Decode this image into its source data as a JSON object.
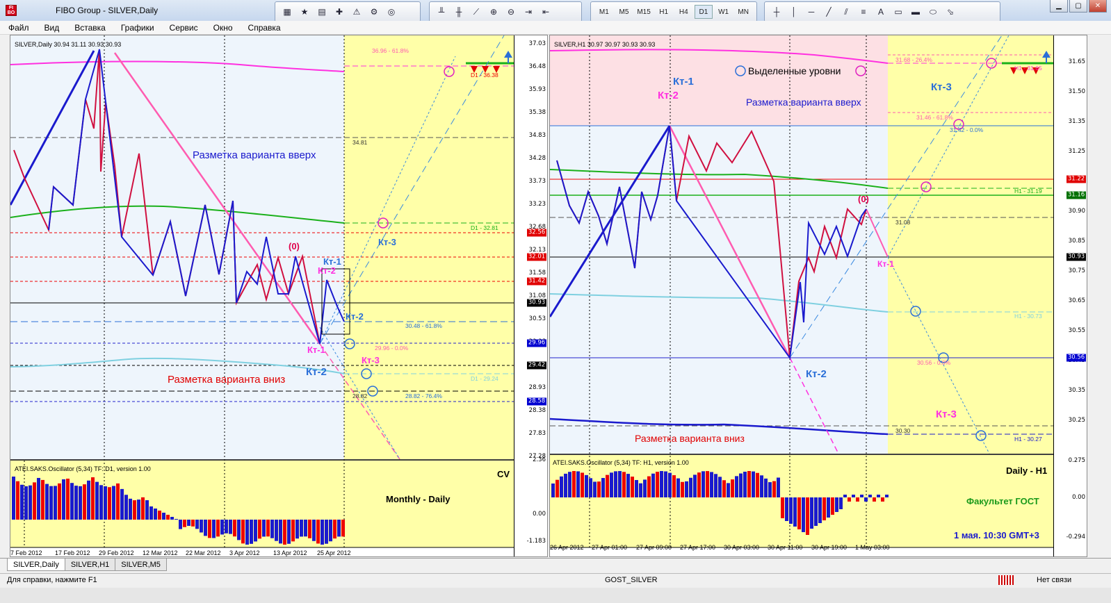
{
  "window": {
    "title": "FIBO Group - SILVER,Daily"
  },
  "menu": [
    "Файл",
    "Вид",
    "Вставка",
    "Графики",
    "Сервис",
    "Окно",
    "Справка"
  ],
  "toolbar": {
    "timeframes": [
      "M1",
      "M5",
      "M15",
      "H1",
      "H4",
      "D1",
      "W1",
      "MN"
    ],
    "selected_tf": "D1"
  },
  "left_chart": {
    "header": "SILVER,Daily  30.94 31.11 30.93 30.93",
    "price_ticks": [
      "37.03",
      "36.48",
      "35.93",
      "35.38",
      "34.83",
      "34.28",
      "33.73",
      "33.23",
      "32.68",
      "32.13",
      "31.58",
      "31.08",
      "30.53",
      "29.98",
      "29.43",
      "28.93",
      "28.38",
      "27.83",
      "27.28"
    ],
    "price_tags": [
      {
        "text": "32.56",
        "color": "red"
      },
      {
        "text": "32.01",
        "color": "red"
      },
      {
        "text": "31.42",
        "color": "red"
      },
      {
        "text": "30.93",
        "color": "black"
      },
      {
        "text": "29.96",
        "color": "blue"
      },
      {
        "text": "29.42",
        "color": "black"
      },
      {
        "text": "28.58",
        "color": "blue"
      }
    ],
    "level_labels": [
      "36.96 - 61.8%",
      "D1 - 36.38",
      "34.81",
      "D1 - 32.81",
      "30.48 - 61.8%",
      "29.96 - 0.0%",
      "D1 - 29.24",
      "28.82",
      "28.82 - 76.4%"
    ],
    "annotations": {
      "up_variant": "Разметка варианта вверх",
      "down_variant": "Разметка варианта вниз",
      "kt1_top": "Кт-1",
      "kt2_top": "Кт-2",
      "kt2_mid": "Кт-2",
      "kt3_top": "Кт-3",
      "kt1_low": "Кт-1",
      "kt3_low": "Кт-3",
      "kt2_low": "Кт-2",
      "zero": "(0)"
    },
    "oscillator": {
      "header": "ATEI.SAKS.Oscillator (5,34)  TF: D1, version 1.00",
      "ticks": [
        "2.36",
        "0.00",
        "-1.183"
      ],
      "label_cv": "CV",
      "label_period": "Monthly - Daily"
    },
    "dates": [
      "7 Feb 2012",
      "17 Feb 2012",
      "29 Feb 2012",
      "12 Mar 2012",
      "22 Mar 2012",
      "3 Apr 2012",
      "13 Apr 2012",
      "25 Apr 2012"
    ]
  },
  "right_chart": {
    "header": "SILVER,H1  30.97 30.97 30.93 30.93",
    "price_ticks": [
      "31.65",
      "31.50",
      "31.35",
      "31.25",
      "31.05",
      "30.90",
      "30.85",
      "30.75",
      "30.65",
      "30.55",
      "30.45",
      "30.35",
      "30.25"
    ],
    "price_tags": [
      {
        "text": "31.22",
        "color": "red"
      },
      {
        "text": "31.16",
        "color": "green"
      },
      {
        "text": "30.93",
        "color": "black"
      },
      {
        "text": "30.56",
        "color": "blue"
      }
    ],
    "level_labels": [
      "31.68 - 26.4%",
      "H1 - 31.65",
      "31.46 - 61.8%",
      "31.42 - 0.0%",
      "H1 - 31.19",
      "31.08",
      "H1 - 30.73",
      "30.56 - 0.0%",
      "30.30",
      "H1 - 30.27"
    ],
    "annotations": {
      "kt1_top": "Кт-1",
      "kt2_top": "Кт-2",
      "selected_levels": "Выделенные уровни",
      "up_variant": "Разметка варианта вверх",
      "kt3_top": "Кт-3",
      "zero": "(0)",
      "kt1_mid": "Кт-1",
      "kt2_low": "Кт-2",
      "kt3_low": "Кт-3",
      "down_variant": "Разметка варианта вниз"
    },
    "oscillator": {
      "header": "ATEI.SAKS.Oscillator (5,34)  TF: H1, version 1.00",
      "ticks": [
        "0.275",
        "0.00",
        "-0.294"
      ],
      "label_period": "Daily - H1",
      "label_faculty": "Факультет ГОСТ",
      "label_time": "1 мая. 10:30 GMT+3"
    },
    "dates": [
      "26 Apr 2012",
      "27 Apr 01:00",
      "27 Apr 09:00",
      "27 Apr 17:00",
      "30 Apr 03:00",
      "30 Apr 11:00",
      "30 Apr 19:00",
      "1 May 03:00"
    ]
  },
  "tabs": [
    "SILVER,Daily",
    "SILVER,H1",
    "SILVER,M5"
  ],
  "status": {
    "help": "Для справки, нажмите F1",
    "profile": "GOST_SILVER",
    "connection": "Нет связи"
  },
  "colors": {
    "up_line": "#d01040",
    "down_line": "#1a1acd",
    "fibo_pink": "#ff5bb0",
    "ma_magenta": "#ff30e0",
    "ma_green": "#1ab01a",
    "ma_cyan": "#7fd0e0",
    "zone_yellow": "#ffffa8",
    "zone_blue": "#eef5fc",
    "zone_pink": "#fde0e4"
  }
}
